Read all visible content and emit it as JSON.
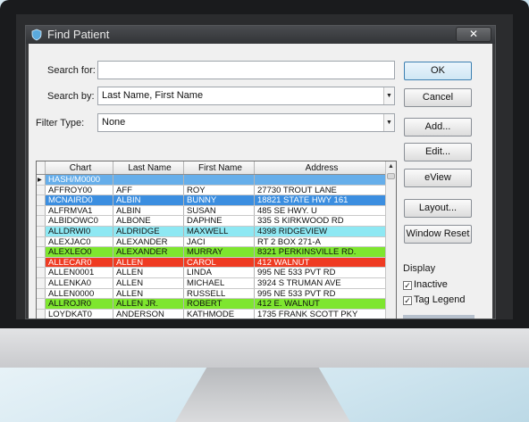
{
  "window": {
    "title": "Find Patient",
    "close_label": "✕"
  },
  "form": {
    "search_for_label": "Search for:",
    "search_for_value": "",
    "search_by_label": "Search by:",
    "search_by_value": "Last Name, First Name",
    "filter_type_label": "Filter Type:",
    "filter_type_value": "None"
  },
  "buttons": {
    "ok": "OK",
    "cancel": "Cancel",
    "add": "Add...",
    "edit": "Edit...",
    "eview": "eView",
    "layout": "Layout...",
    "window_reset": "Window Reset"
  },
  "display": {
    "label": "Display",
    "inactive_label": "Inactive",
    "inactive_checked": "✓",
    "tag_legend_label": "Tag Legend",
    "tag_legend_checked": "✓"
  },
  "grid": {
    "columns": [
      "Chart",
      "Last Name",
      "First Name",
      "Address"
    ],
    "rows": [
      {
        "indicator": "▸",
        "chart": "HASH/M0000",
        "last": "",
        "first": "",
        "address": "",
        "bg": "#66aeea",
        "fg": "#ffffff"
      },
      {
        "indicator": "",
        "chart": "AFFROY00",
        "last": "AFF",
        "first": "ROY",
        "address": "27730 TROUT LANE",
        "bg": "#ffffff",
        "fg": "#111111"
      },
      {
        "indicator": "",
        "chart": "MCNAIRD0",
        "last": "ALBIN",
        "first": "BUNNY",
        "address": "18821 STATE HWY 161",
        "bg": "#3b8ee0",
        "fg": "#ffffff"
      },
      {
        "indicator": "",
        "chart": "ALFRMVA1",
        "last": "ALBIN",
        "first": "SUSAN",
        "address": "485 SE HWY. U",
        "bg": "#ffffff",
        "fg": "#111111"
      },
      {
        "indicator": "",
        "chart": "ALBIDOWC0",
        "last": "ALBONE",
        "first": "DAPHNE",
        "address": "335 S KIRKWOOD RD",
        "bg": "#ffffff",
        "fg": "#111111"
      },
      {
        "indicator": "",
        "chart": "ALLDRWI0",
        "last": "ALDRIDGE",
        "first": "MAXWELL",
        "address": "4398 RIDGEVIEW",
        "bg": "#8ee8f3",
        "fg": "#111111"
      },
      {
        "indicator": "",
        "chart": "ALEXJAC0",
        "last": "ALEXANDER",
        "first": "JACI",
        "address": "RT 2 BOX 271-A",
        "bg": "#ffffff",
        "fg": "#111111"
      },
      {
        "indicator": "",
        "chart": "ALEXLEO0",
        "last": "ALEXANDER",
        "first": "MURRAY",
        "address": "8321 PERKINSVILLE RD.",
        "bg": "#7ee62f",
        "fg": "#111111"
      },
      {
        "indicator": "",
        "chart": "ALLECAR0",
        "last": "ALLEN",
        "first": "CAROL",
        "address": "412 WALNUT",
        "bg": "#ef3b22",
        "fg": "#ffffff"
      },
      {
        "indicator": "",
        "chart": "ALLEN0001",
        "last": "ALLEN",
        "first": "LINDA",
        "address": "995 NE 533 PVT RD",
        "bg": "#ffffff",
        "fg": "#111111"
      },
      {
        "indicator": "",
        "chart": "ALLENKA0",
        "last": "ALLEN",
        "first": "MICHAEL",
        "address": "3924 S TRUMAN AVE",
        "bg": "#ffffff",
        "fg": "#111111"
      },
      {
        "indicator": "",
        "chart": "ALLEN0000",
        "last": "ALLEN",
        "first": "RUSSELL",
        "address": "995 NE 533 PVT RD",
        "bg": "#ffffff",
        "fg": "#111111"
      },
      {
        "indicator": "",
        "chart": "ALLROJR0",
        "last": "ALLEN JR.",
        "first": "ROBERT",
        "address": "412 E. WALNUT",
        "bg": "#7ee62f",
        "fg": "#111111"
      },
      {
        "indicator": "",
        "chart": "LOYDKAT0",
        "last": "ANDERSON",
        "first": "KATHMODE",
        "address": "1735 FRANK SCOTT PKY",
        "bg": "#ffffff",
        "fg": "#111111"
      }
    ]
  }
}
